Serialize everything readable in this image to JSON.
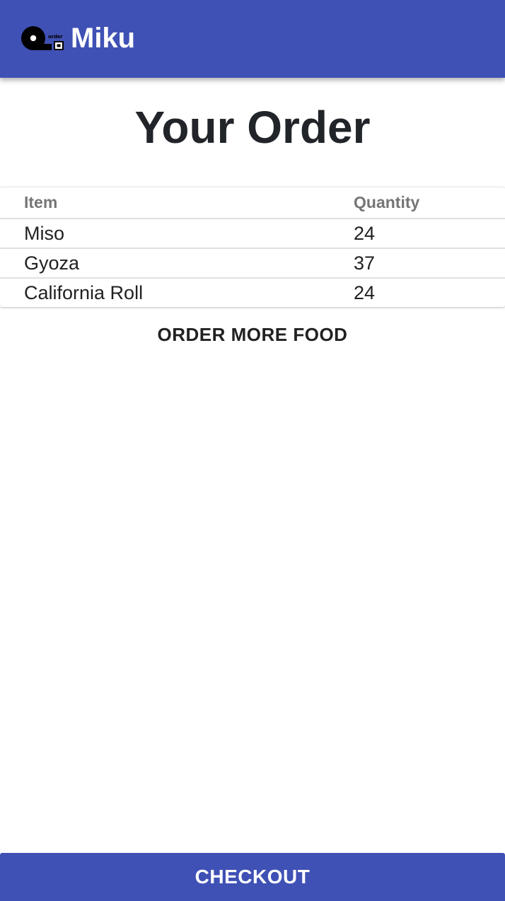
{
  "app_bar": {
    "title": "Miku",
    "logo_text": "order",
    "color": "#3f51b5"
  },
  "page_title": "Your Order",
  "order_table": {
    "columns": [
      "Item",
      "Quantity"
    ],
    "rows": [
      {
        "item": "Miso",
        "quantity": "24"
      },
      {
        "item": "Gyoza",
        "quantity": "37"
      },
      {
        "item": "California Roll",
        "quantity": "24"
      }
    ]
  },
  "actions": {
    "order_more_label": "ORDER MORE FOOD",
    "checkout_label": "CHECKOUT"
  },
  "icons": {
    "logo": "order-logo-icon"
  }
}
